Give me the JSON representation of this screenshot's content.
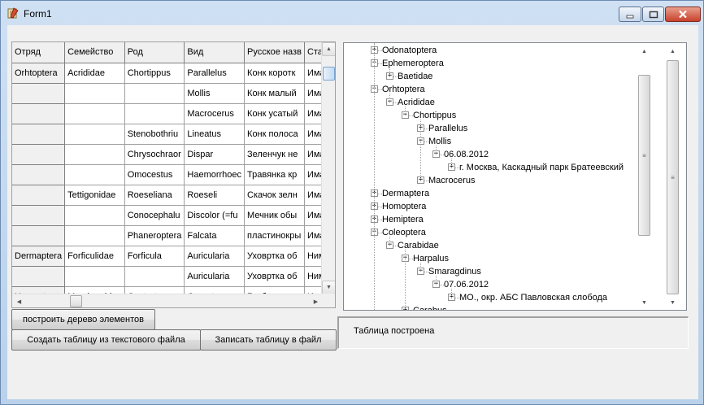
{
  "window": {
    "title": "Form1"
  },
  "grid": {
    "headers": [
      "Отряд",
      "Семейство",
      "Род",
      "Вид",
      "Русское назв",
      "Стадия"
    ],
    "rows": [
      [
        "Orhtoptera",
        "Acrididae",
        "Chortippus",
        "Parallelus",
        "Конк коротк",
        "Имаго"
      ],
      [
        "",
        "",
        "",
        "Mollis",
        "Конк малый",
        "Имаго"
      ],
      [
        "",
        "",
        "",
        "Macrocerus",
        "Конк усатый",
        "Имаго"
      ],
      [
        "",
        "",
        "Stenobothriu",
        "Lineatus",
        "Конк полоса",
        "Имаго"
      ],
      [
        "",
        "",
        "Chrysochraor",
        "Dispar",
        "Зеленчук не",
        "Имаго"
      ],
      [
        "",
        "",
        "Omocestus",
        "Haemorrhoec",
        "Травянка кр",
        "Имаго"
      ],
      [
        "",
        "Tettigonidae",
        "Roeseliana",
        "Roeseli",
        "Скачок зелн",
        "Имаго"
      ],
      [
        "",
        "",
        "Conocephalu",
        "Discolor (=fu",
        "Мечник обы",
        "Имаго"
      ],
      [
        "",
        "",
        "Phaneroptera",
        "Falcata",
        "пластинокры",
        "Имаго"
      ],
      [
        "Dermaptera",
        "Forficulidae",
        "Forficula",
        "Auricularia",
        "Уховртка об",
        "Нимфа"
      ],
      [
        "",
        "",
        "",
        "Auricularia",
        "Уховртка об",
        "Нимфа"
      ],
      [
        "Homoptera",
        "Membracidae",
        "Centrotus",
        "Cornuta",
        "Горбатка ро",
        "Имаго"
      ]
    ]
  },
  "tree": {
    "nodes": [
      {
        "label": "Odonatoptera",
        "level": 0,
        "expander": "+"
      },
      {
        "label": "Ephemeroptera",
        "level": 0,
        "expander": "−"
      },
      {
        "label": "Baetidae",
        "level": 1,
        "expander": "+"
      },
      {
        "label": "Orhtoptera",
        "level": 0,
        "expander": "−"
      },
      {
        "label": "Acrididae",
        "level": 1,
        "expander": "−"
      },
      {
        "label": "Chortippus",
        "level": 2,
        "expander": "−"
      },
      {
        "label": "Parallelus",
        "level": 3,
        "expander": "+"
      },
      {
        "label": "Mollis",
        "level": 3,
        "expander": "−"
      },
      {
        "label": "06.08.2012",
        "level": 4,
        "expander": "−"
      },
      {
        "label": "г. Москва, Каскадный парк Братеевский",
        "level": 5,
        "expander": "+"
      },
      {
        "label": "Macrocerus",
        "level": 3,
        "expander": "+"
      },
      {
        "label": "Dermaptera",
        "level": 0,
        "expander": "+"
      },
      {
        "label": "Homoptera",
        "level": 0,
        "expander": "+"
      },
      {
        "label": "Hemiptera",
        "level": 0,
        "expander": "+"
      },
      {
        "label": "Coleoptera",
        "level": 0,
        "expander": "−"
      },
      {
        "label": "Carabidae",
        "level": 1,
        "expander": "−"
      },
      {
        "label": "Harpalus",
        "level": 2,
        "expander": "−"
      },
      {
        "label": "Smaragdinus",
        "level": 3,
        "expander": "−"
      },
      {
        "label": "07.06.2012",
        "level": 4,
        "expander": "−"
      },
      {
        "label": "МО., окр. АБС Павловская слобода",
        "level": 5,
        "expander": "+"
      },
      {
        "label": "Carabus",
        "level": 2,
        "expander": "+"
      }
    ]
  },
  "buttons": {
    "build_tree": "построить дерево элементов",
    "create_table": "Создать таблицу из текстового файла",
    "save_table": "Записать таблицу в файл"
  },
  "status": {
    "text": "Таблица построена"
  }
}
